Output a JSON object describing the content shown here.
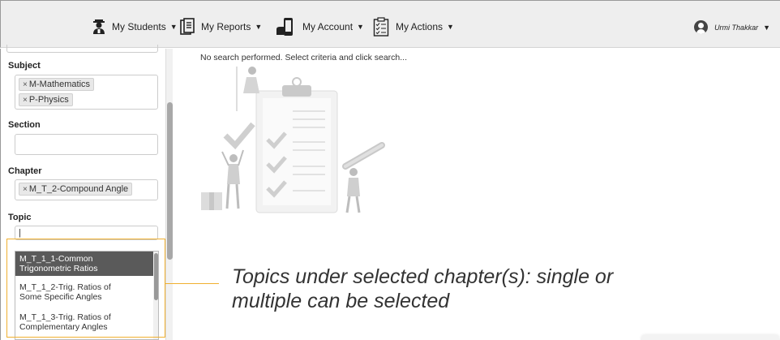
{
  "nav": {
    "students": "My Students",
    "reports": "My Reports",
    "account": "My Account",
    "actions": "My Actions",
    "caret": "▼"
  },
  "user": {
    "name": "Urmi Thakkar"
  },
  "filters": {
    "subject": {
      "label": "Subject",
      "tags": [
        "M-Mathematics",
        "P-Physics"
      ]
    },
    "section": {
      "label": "Section"
    },
    "chapter": {
      "label": "Chapter",
      "tags": [
        "M_T_2-Compound Angle"
      ]
    },
    "topic": {
      "label": "Topic",
      "input_value": "|"
    },
    "tag_remove": "×"
  },
  "topic_options": [
    {
      "line1": "M_T_1_1-Common",
      "line2": "Trigonometric Ratios",
      "active": true
    },
    {
      "line1": "M_T_1_2-Trig. Ratios of",
      "line2": "Some Specific Angles",
      "active": false
    },
    {
      "line1": "M_T_1_3-Trig. Ratios of",
      "line2": "Complementary Angles",
      "active": false
    }
  ],
  "status_message": "No search performed. Select criteria and click search...",
  "annotation": {
    "line1": "Topics under selected chapter(s): single or",
    "line2": "multiple can be selected"
  },
  "colors": {
    "highlight": "#f0b030",
    "active_option": "#5a5a5a"
  }
}
